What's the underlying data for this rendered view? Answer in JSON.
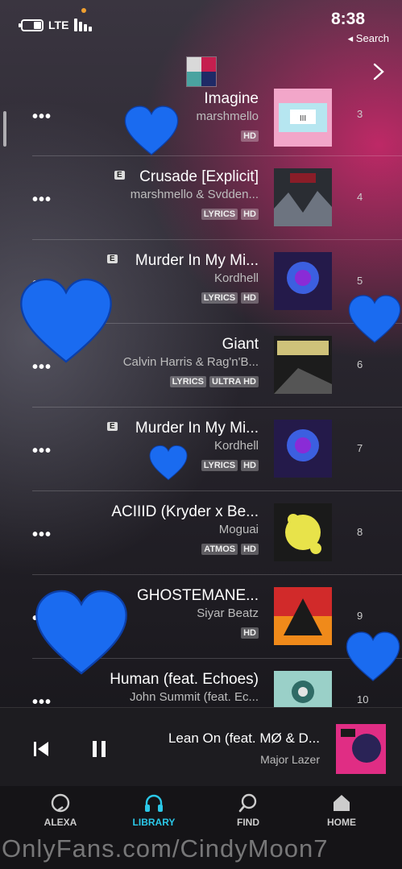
{
  "status_bar": {
    "time": "8:38",
    "network": "LTE",
    "back_label": "◂ Search"
  },
  "tracks": [
    {
      "number": "3",
      "title": "Imagine",
      "artist": "marshmello",
      "badges": [
        "HD"
      ],
      "explicit": false
    },
    {
      "number": "4",
      "title": "Crusade [Explicit]",
      "artist": "marshmello & Svdden...",
      "badges": [
        "HD",
        "LYRICS"
      ],
      "explicit": true
    },
    {
      "number": "5",
      "title": "Murder In My Mi...",
      "artist": "Kordhell",
      "badges": [
        "HD",
        "LYRICS"
      ],
      "explicit": true
    },
    {
      "number": "6",
      "title": "Giant",
      "artist": "Calvin Harris & Rag'n'B...",
      "badges": [
        "ULTRA HD",
        "LYRICS"
      ],
      "explicit": false
    },
    {
      "number": "7",
      "title": "Murder In My Mi...",
      "artist": "Kordhell",
      "badges": [
        "HD",
        "LYRICS"
      ],
      "explicit": true
    },
    {
      "number": "8",
      "title": "ACIIID (Kryder x Be...",
      "artist": "Moguai",
      "badges": [
        "HD",
        "ATMOS"
      ],
      "explicit": false
    },
    {
      "number": "9",
      "title": "GHOSTEMANE...",
      "artist": "Siyar Beatz",
      "badges": [
        "HD"
      ],
      "explicit": false
    },
    {
      "number": "10",
      "title": "Human (feat. Echoes)",
      "artist": "John Summit (feat. Ec...",
      "badges": [],
      "explicit": false
    }
  ],
  "explicit_badge": "E",
  "more_label": "•••",
  "now_playing": {
    "title": "Lean On (feat. MØ & D...",
    "artist": "Major Lazer"
  },
  "tabs": [
    {
      "label": "HOME",
      "icon": "home-icon",
      "active": false
    },
    {
      "label": "FIND",
      "icon": "search-icon",
      "active": false
    },
    {
      "label": "LIBRARY",
      "icon": "headphones-icon",
      "active": true
    },
    {
      "label": "ALEXA",
      "icon": "alexa-icon",
      "active": false
    }
  ],
  "watermark": "OnlyFans.com/CindyMoon7",
  "colors": {
    "accent": "#2bc8e8",
    "heart": "#1a6bf0",
    "background_pink": "#d6286e"
  }
}
